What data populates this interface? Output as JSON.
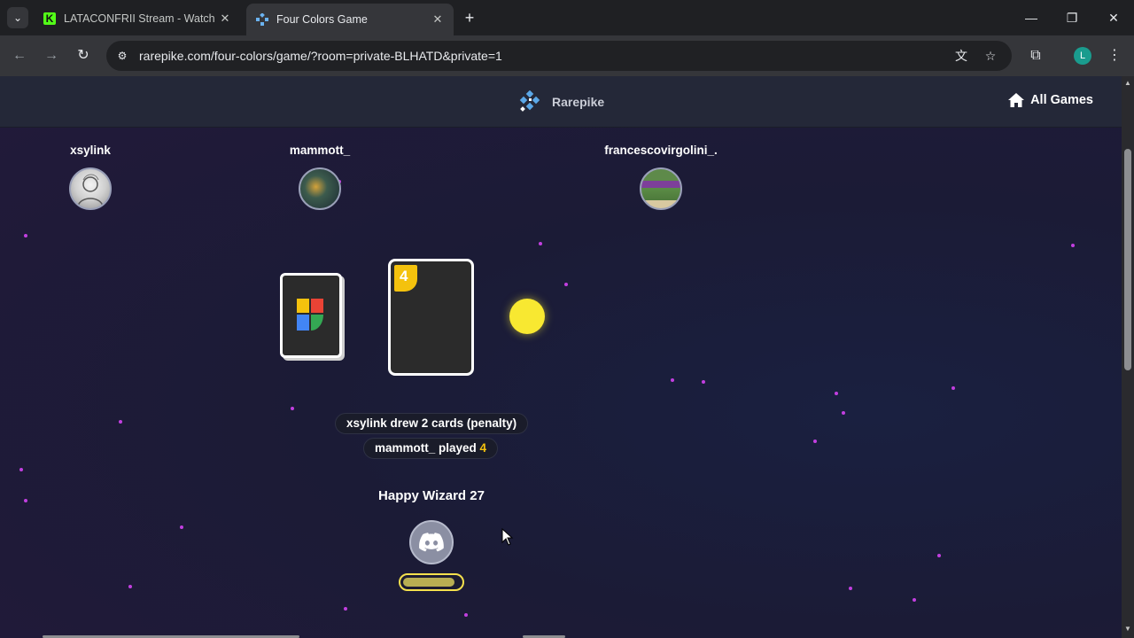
{
  "browser": {
    "tabs": [
      {
        "title": "LATACONFRII Stream - Watch Li",
        "icon": "kick-icon",
        "active": false
      },
      {
        "title": "Four Colors Game",
        "icon": "rarepike-icon",
        "active": true
      }
    ],
    "url": "rarepike.com/four-colors/game/?room=private-BLHATD&private=1",
    "profile_initial": "L"
  },
  "site": {
    "brand": "Rarepike",
    "all_games_label": "All Games"
  },
  "players": [
    {
      "name": "xsylink"
    },
    {
      "name": "mammott_"
    },
    {
      "name": "francescovirgolini_."
    }
  ],
  "game": {
    "top_card_value": "4",
    "top_card_color": "#f4c20d",
    "current_color": "#f8e831",
    "log": [
      {
        "text": "xsylink drew 2 cards (penalty)"
      },
      {
        "prefix": "mammott_ played ",
        "value": "4"
      }
    ],
    "me": {
      "name": "Happy Wizard 27",
      "timer_fraction": 0.9
    }
  }
}
